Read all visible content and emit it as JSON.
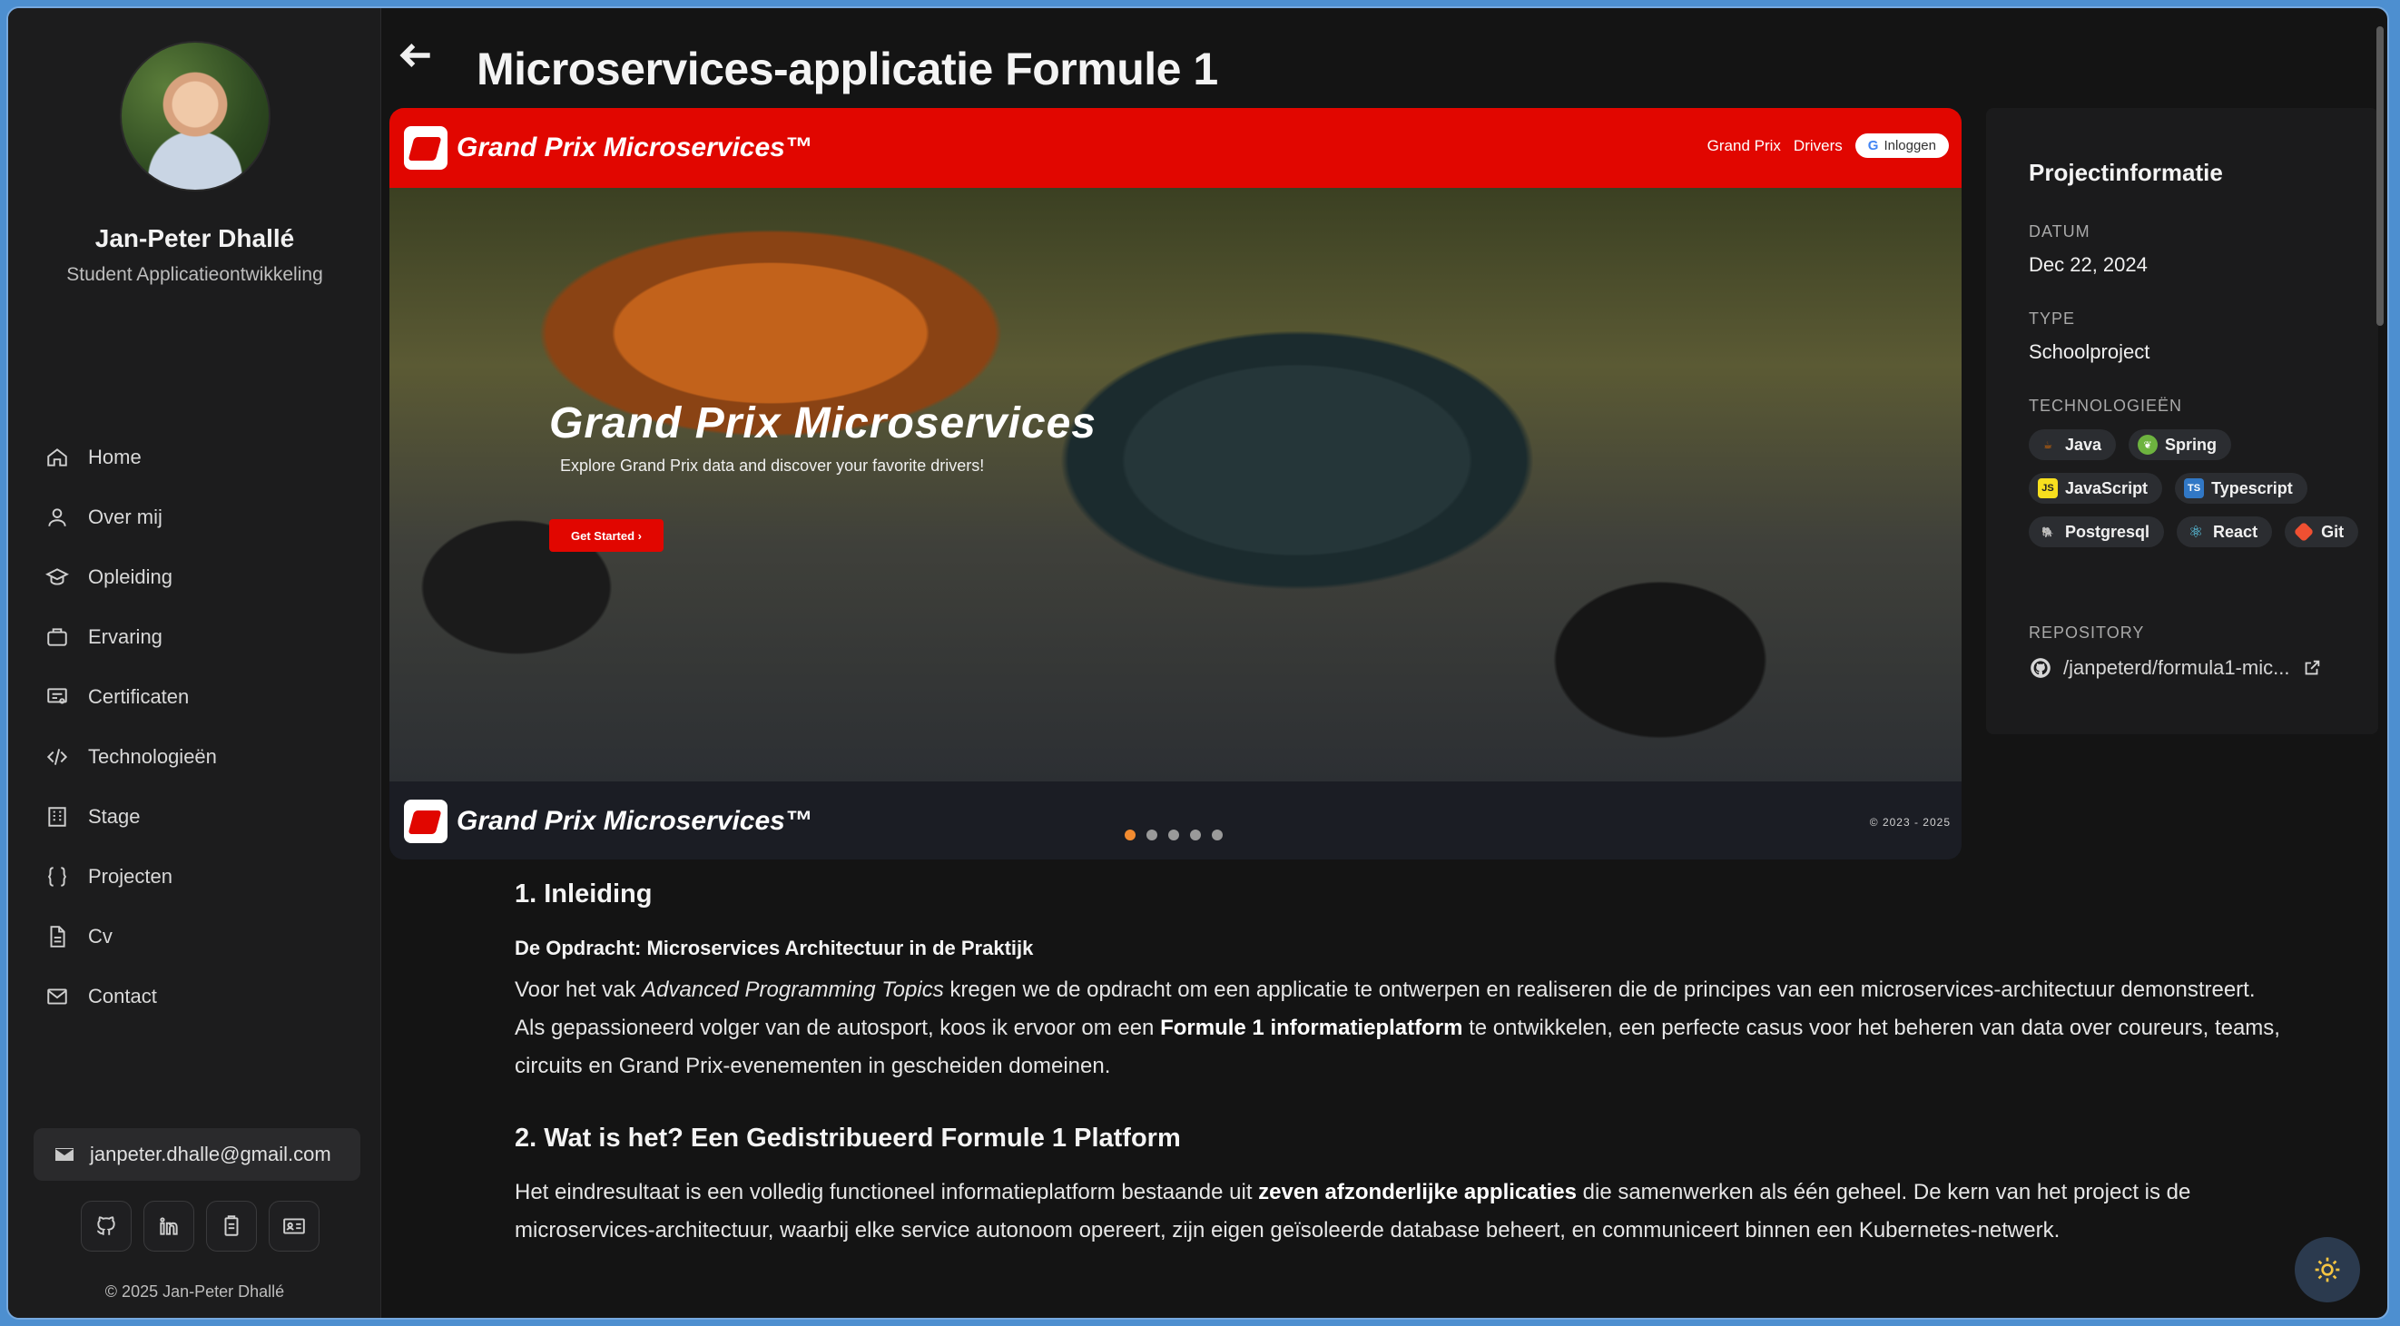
{
  "profile": {
    "name": "Jan-Peter Dhallé",
    "role": "Student Applicatieontwikkeling"
  },
  "sidebar": {
    "items": [
      {
        "label": "Home",
        "icon": "home-icon"
      },
      {
        "label": "Over mij",
        "icon": "user-icon"
      },
      {
        "label": "Opleiding",
        "icon": "graduation-cap-icon"
      },
      {
        "label": "Ervaring",
        "icon": "briefcase-icon"
      },
      {
        "label": "Certificaten",
        "icon": "certificate-icon"
      },
      {
        "label": "Technologieën",
        "icon": "code-icon"
      },
      {
        "label": "Stage",
        "icon": "building-icon"
      },
      {
        "label": "Projecten",
        "icon": "braces-icon"
      },
      {
        "label": "Cv",
        "icon": "document-icon"
      },
      {
        "label": "Contact",
        "icon": "mail-icon"
      }
    ],
    "email": "janpeter.dhalle@gmail.com",
    "copyright": "© 2025 Jan-Peter Dhallé"
  },
  "page": {
    "title": "Microservices-applicatie Formule 1"
  },
  "carousel": {
    "brand": "Grand Prix Microservices™",
    "nav_grand_prix": "Grand Prix",
    "nav_drivers": "Drivers",
    "login": "Inloggen",
    "hero_title": "Grand Prix Microservices",
    "hero_subtitle": "Explore Grand Prix data and discover your favorite drivers!",
    "hero_button": "Get Started",
    "footer_brand": "Grand Prix Microservices™",
    "footer_copy": "© 2023 - 2025",
    "slides": 5,
    "active_slide": 1
  },
  "info": {
    "title": "Projectinformatie",
    "date_label": "DATUM",
    "date_value": "Dec 22, 2024",
    "type_label": "TYPE",
    "type_value": "Schoolproject",
    "tech_label": "TECHNOLOGIEËN",
    "technologies": [
      {
        "name": "Java",
        "color": "#e76f00"
      },
      {
        "name": "Spring",
        "color": "#6db33f"
      },
      {
        "name": "JavaScript",
        "color": "#f7df1e"
      },
      {
        "name": "Typescript",
        "color": "#3178c6"
      },
      {
        "name": "Postgresql",
        "color": "#336791"
      },
      {
        "name": "React",
        "color": "#61dafb"
      },
      {
        "name": "Git",
        "color": "#f05032"
      }
    ],
    "repo_label": "REPOSITORY",
    "repo_value": "/janpeterd/formula1-mic..."
  },
  "article": {
    "h1": "1. Inleiding",
    "sub1": "De Opdracht: Microservices Architectuur in de Praktijk",
    "p1_a": "Voor het vak ",
    "p1_em": "Advanced Programming Topics",
    "p1_b": " kregen we de opdracht om een applicatie te ontwerpen en realiseren die de principes van een microservices-architectuur demonstreert. Als gepassioneerd volger van de autosport, koos ik ervoor om een ",
    "p1_strong": "Formule 1 informatieplatform",
    "p1_c": " te ontwikkelen, een perfecte casus voor het beheren van data over coureurs, teams, circuits en Grand Prix-evenementen in gescheiden domeinen.",
    "h2": "2. Wat is het? Een Gedistribueerd Formule 1 Platform",
    "p2_a": "Het eindresultaat is een volledig functioneel informatieplatform bestaande uit ",
    "p2_strong": "zeven afzonderlijke applicaties",
    "p2_b": " die samenwerken als één geheel. De kern van het project is de microservices-architectuur, waarbij elke service autonoom opereert, zijn eigen geïsoleerde database beheert, en communiceert binnen een Kubernetes-netwerk."
  }
}
